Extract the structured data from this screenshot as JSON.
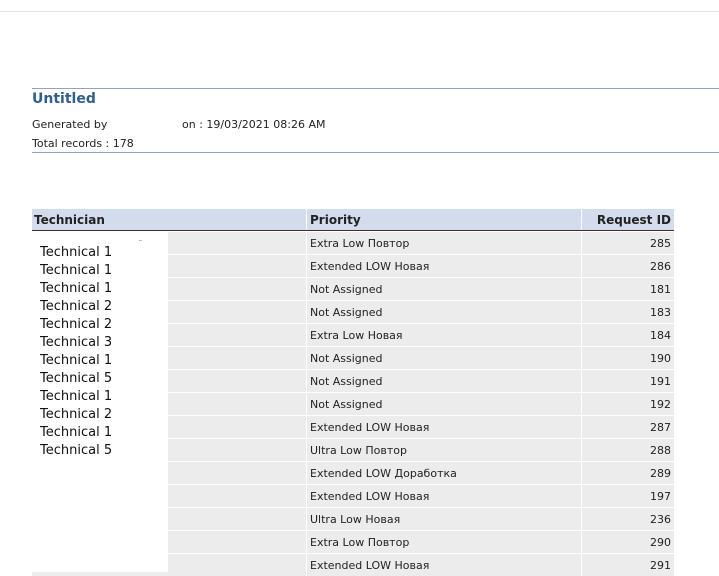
{
  "report": {
    "title": "Untitled",
    "generated_by_label": "Generated by",
    "generated_on": "on : 19/03/2021 08:26 AM",
    "total_records": "Total records : 178"
  },
  "table": {
    "headers": {
      "technician": "Technician",
      "priority": "Priority",
      "request_id": "Request ID"
    },
    "rows": [
      {
        "priority": "Extra Low Повтор",
        "id": "285"
      },
      {
        "priority": "Extended LOW Новая",
        "id": "286"
      },
      {
        "priority": "Not Assigned",
        "id": "181"
      },
      {
        "priority": "Not Assigned",
        "id": "183"
      },
      {
        "priority": "Extra Low Новая",
        "id": "184"
      },
      {
        "priority": "Not Assigned",
        "id": "190"
      },
      {
        "priority": "Not Assigned",
        "id": "191"
      },
      {
        "priority": "Not Assigned",
        "id": "192"
      },
      {
        "priority": "Extended LOW Новая",
        "id": "287"
      },
      {
        "priority": "Ultra Low Повтор",
        "id": "288"
      },
      {
        "priority": "Extended LOW Доработка",
        "id": "289"
      },
      {
        "priority": "Extended LOW Новая",
        "id": "197"
      },
      {
        "priority": "Ultra Low Новая",
        "id": "236"
      },
      {
        "priority": "Extra Low Повтор",
        "id": "290"
      },
      {
        "priority": "Extended LOW Новая",
        "id": "291"
      }
    ]
  },
  "technicians": [
    "Technical 1",
    "Technical 1",
    "Technical 1",
    "Technical 2",
    "Technical 2",
    "Technical 3",
    "Technical 1",
    "Technical 5",
    "Technical 1",
    "Technical 2",
    "Technical 1",
    "Technical 5"
  ]
}
